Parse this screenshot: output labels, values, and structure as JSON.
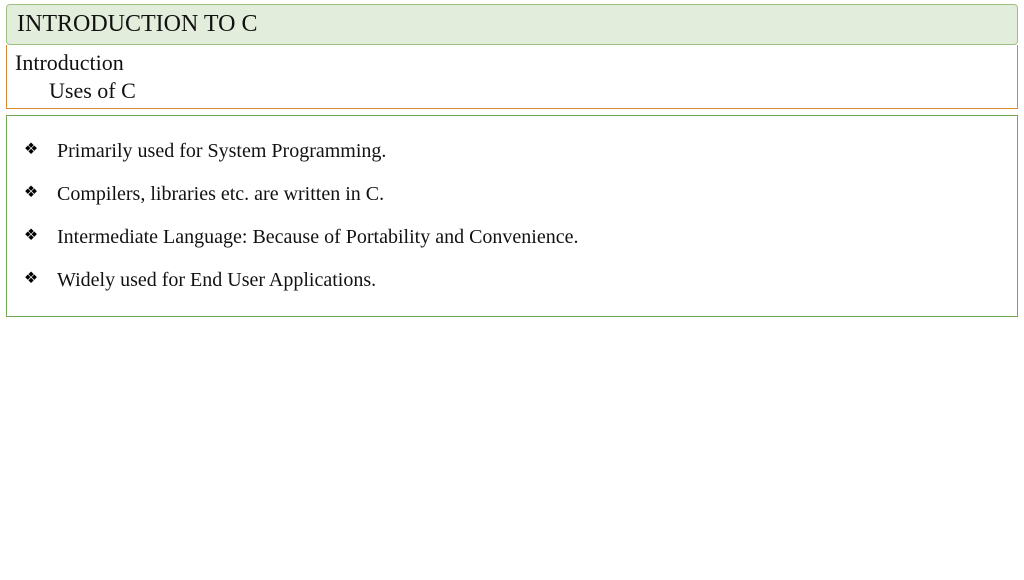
{
  "title": "INTRODUCTION TO C",
  "heading": {
    "main": "Introduction",
    "sub": "Uses of C"
  },
  "bullets": [
    "Primarily used for System Programming.",
    "Compilers, libraries etc. are written in C.",
    "Intermediate Language: Because of Portability and Convenience.",
    "Widely used for End User Applications."
  ]
}
